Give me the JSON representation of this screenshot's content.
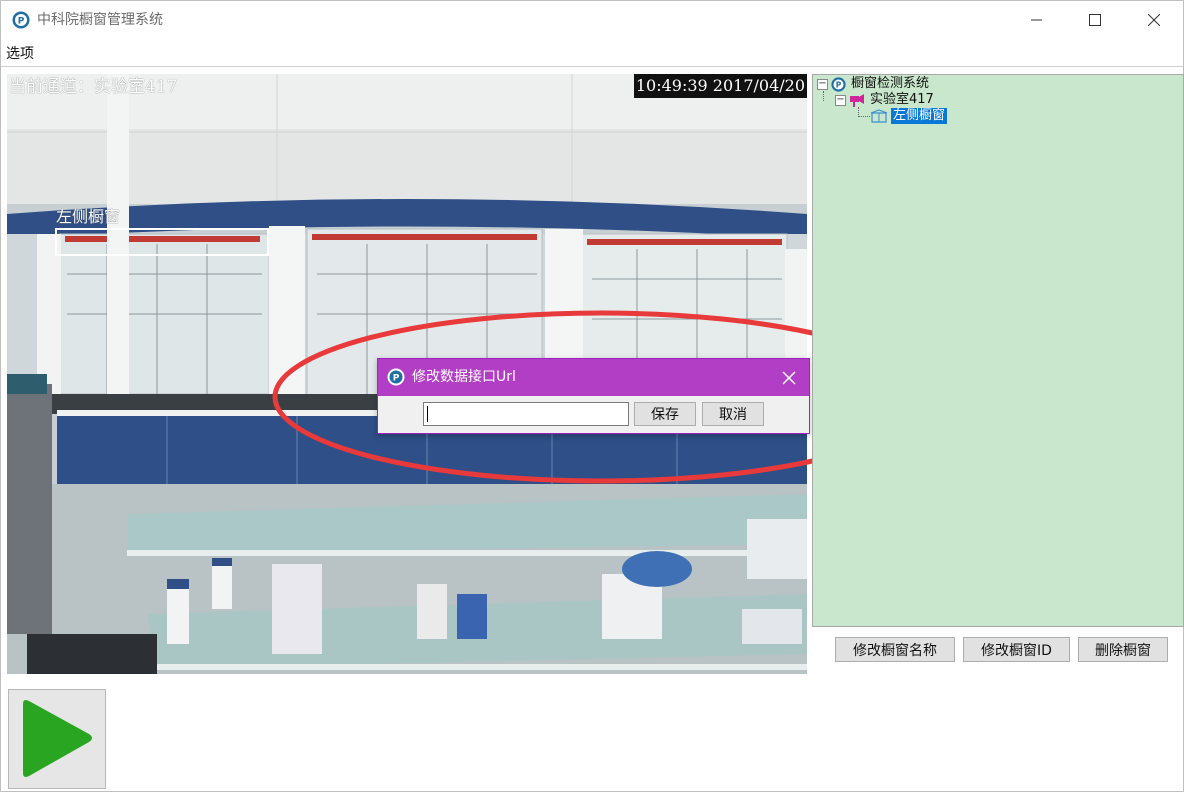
{
  "window": {
    "title": "中科院橱窗管理系统",
    "menu": [
      "选项"
    ]
  },
  "video": {
    "channel_label": "当前通道：实验室417",
    "timestamp": "10:49:39 2017/04/20",
    "roi_label": "左侧橱窗"
  },
  "dialog": {
    "title": "修改数据接口Url",
    "input_value": "",
    "save_label": "保存",
    "cancel_label": "取消"
  },
  "tree": {
    "root": "橱窗检测系统",
    "child": "实验室417",
    "leaf": "左侧橱窗"
  },
  "actions": {
    "rename_label": "修改橱窗名称",
    "modify_id_label": "修改橱窗ID",
    "delete_label": "删除橱窗"
  },
  "colors": {
    "dialog_title_bg": "#b13ec4",
    "tree_bg": "#c9e7cc",
    "annotation_red": "#e83a3a",
    "play_green": "#2aa522",
    "selection_blue": "#0a78d7"
  },
  "icons": {
    "app": "app-logo-icon",
    "minimize": "minimize-icon",
    "maximize": "maximize-icon",
    "close": "close-icon",
    "play": "play-icon"
  }
}
